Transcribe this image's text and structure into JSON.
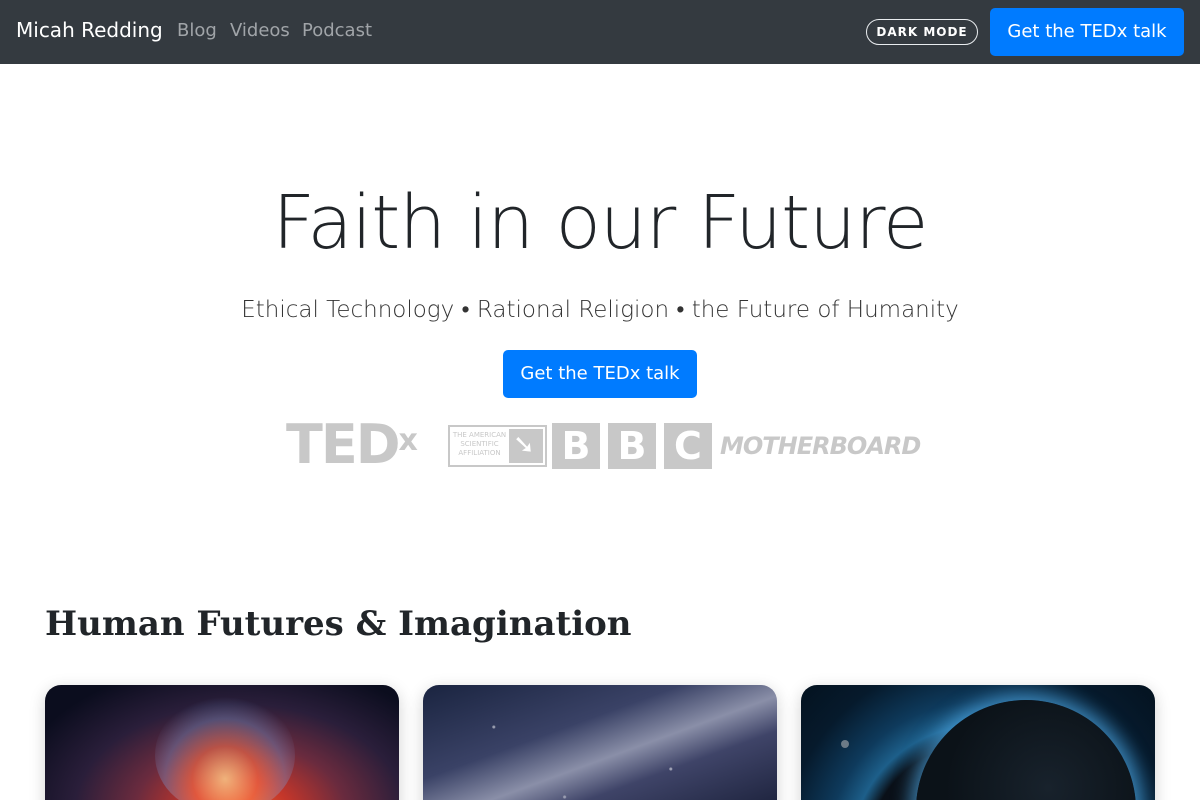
{
  "nav": {
    "brand": "Micah Redding",
    "links": [
      "Blog",
      "Videos",
      "Podcast"
    ],
    "dark_mode_label": "DARK MODE",
    "cta_label": "Get the TEDx talk"
  },
  "hero": {
    "title": "Faith in our Future",
    "subtitle": "Ethical Technology • Rational Religion • the Future of Humanity",
    "cta_label": "Get the TEDx talk",
    "logos": {
      "tedx": "TED",
      "tedx_sup": "x",
      "asa_text": "THE AMERICAN SCIENTIFIC AFFILIATION",
      "bbc": [
        "B",
        "B",
        "C"
      ],
      "motherboard": "MOTHERBOARD"
    }
  },
  "section": {
    "title": "Human Futures & Imagination"
  },
  "colors": {
    "navbar": "#343a40",
    "accent": "#007bff",
    "logo_gray": "#c8c8c8"
  }
}
